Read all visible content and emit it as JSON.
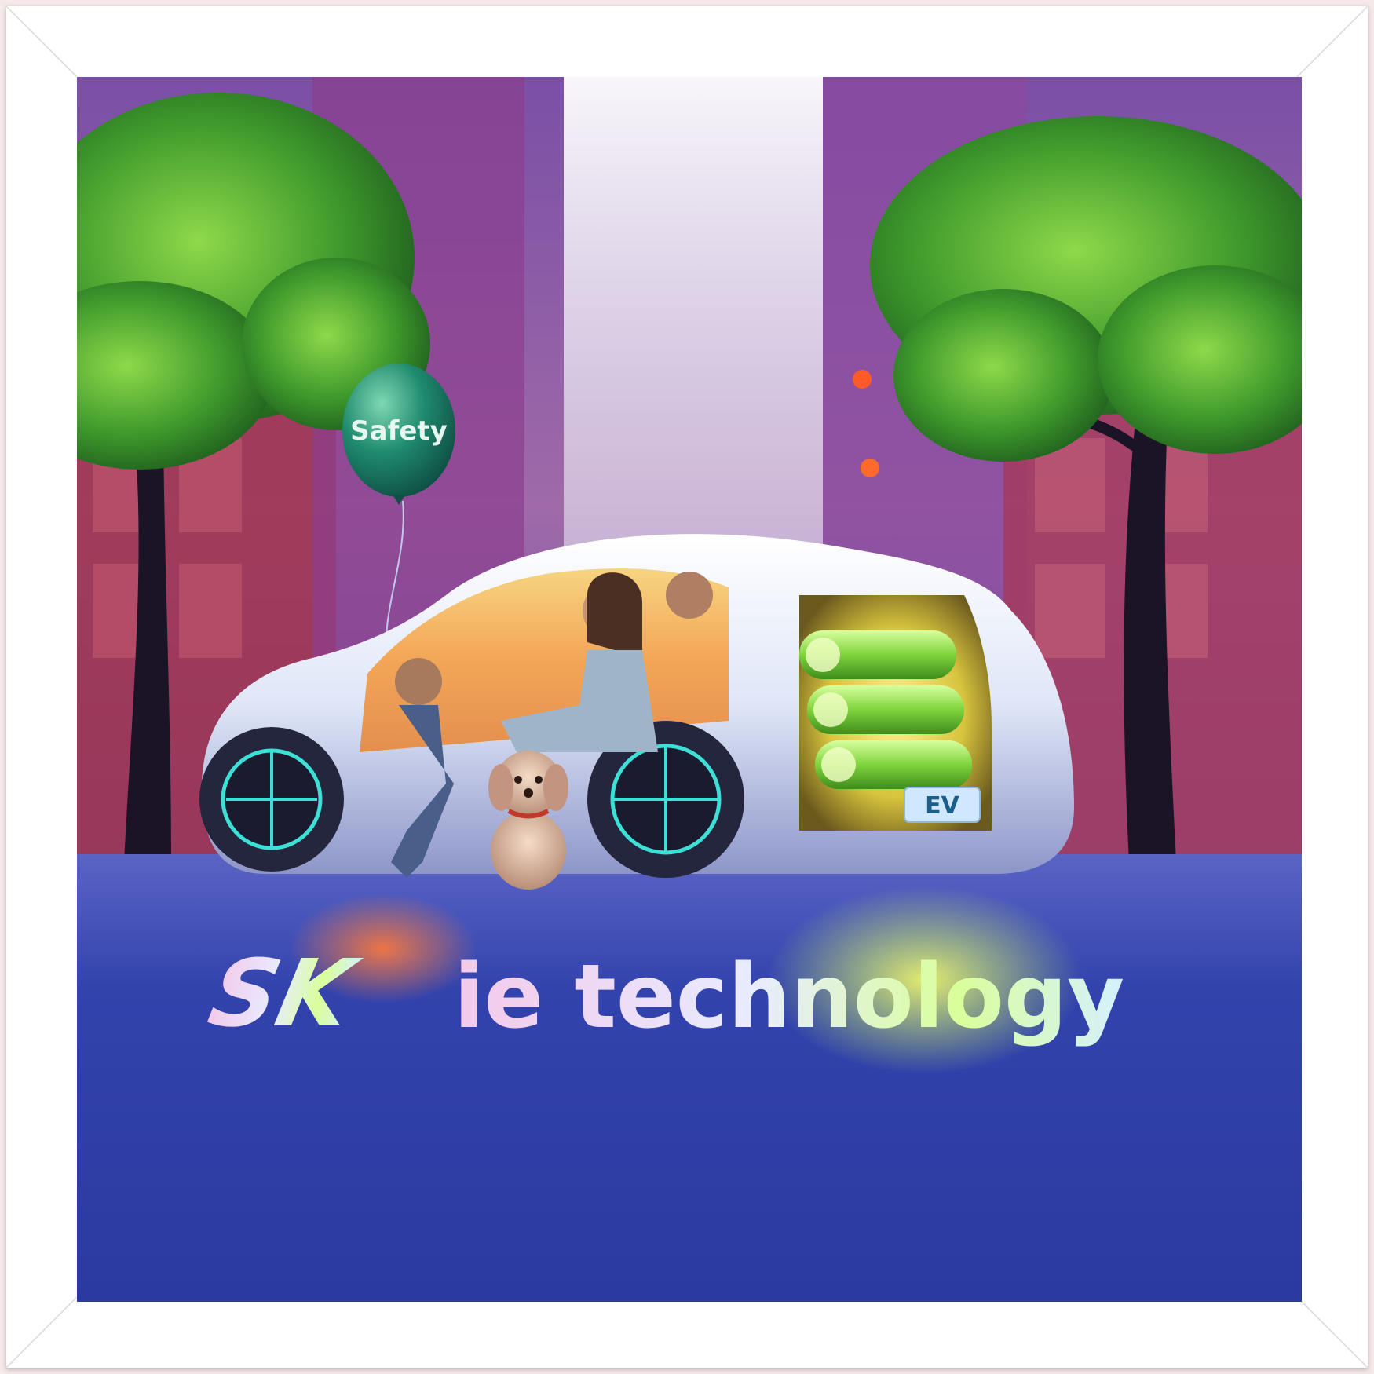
{
  "poster": {
    "balloon_label": "Safety",
    "plate_label": "EV",
    "logo_brand": "SK",
    "logo_rest": "ie technology"
  },
  "colors": {
    "frame": "#ffffff",
    "balloon": "#1f8a6e",
    "road": "#2d3fa8",
    "car_body": "#eef2fb",
    "battery_glow": "#9be85a",
    "wheel_accent": "#3ce0d6"
  },
  "icons": [
    "balloon",
    "car",
    "battery-cells",
    "dog",
    "trees"
  ]
}
